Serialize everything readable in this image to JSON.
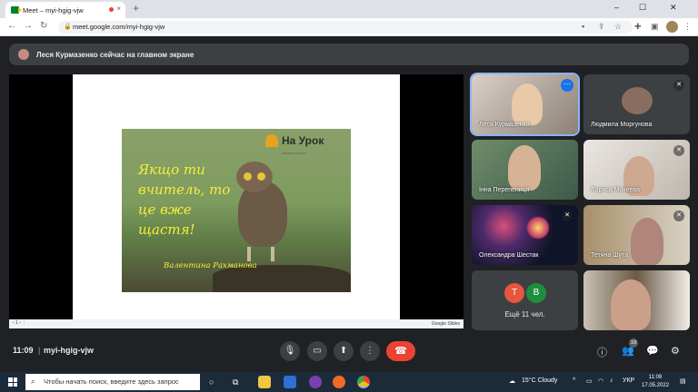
{
  "browser": {
    "tab_title": "Meet – myi-hgig-vjw",
    "tab_close": "×",
    "new_tab": "+",
    "url": "meet.google.com/myi-hgig-vjw",
    "window_controls": [
      "–",
      "☐",
      "✕"
    ]
  },
  "meet": {
    "banner_text": "Леся Курмазенко сейчас на главном экране",
    "slide": {
      "logo_text": "На Урок",
      "logo_sub": "naurok.com.ua",
      "quote": "Якщо ти вчитель, то це вже щастя!",
      "author": "Валентина Рахманова"
    },
    "stage_footer": {
      "page": "‹  1  ›  ⋮",
      "brand": "Google Slides"
    },
    "participants": [
      {
        "name": "Леся Курмазенко",
        "active": true
      },
      {
        "name": "Людмила Моргунова",
        "muted": true
      },
      {
        "name": "Інна Перепелиця"
      },
      {
        "name": "Лариса Мокеева",
        "muted": true
      },
      {
        "name": "Олександра Шестак",
        "muted": true
      },
      {
        "name": "Тетяна Шута",
        "muted": true
      },
      {
        "name": "Ещё 11 чел.",
        "initials": [
          "Т",
          "В"
        ],
        "colors": [
          "#e8553e",
          "#1e8e3e"
        ]
      },
      {
        "name": ""
      }
    ],
    "bottom": {
      "time": "11:09",
      "separator": "|",
      "meeting_code": "myi-hgig-vjw",
      "participants_count": "19"
    }
  },
  "taskbar": {
    "search_placeholder": "Чтобы начать поиск, введите здесь запрос",
    "weather": "15°C  Cloudy",
    "lang": "УКР",
    "time": "11:09",
    "date": "17.05.2022"
  }
}
